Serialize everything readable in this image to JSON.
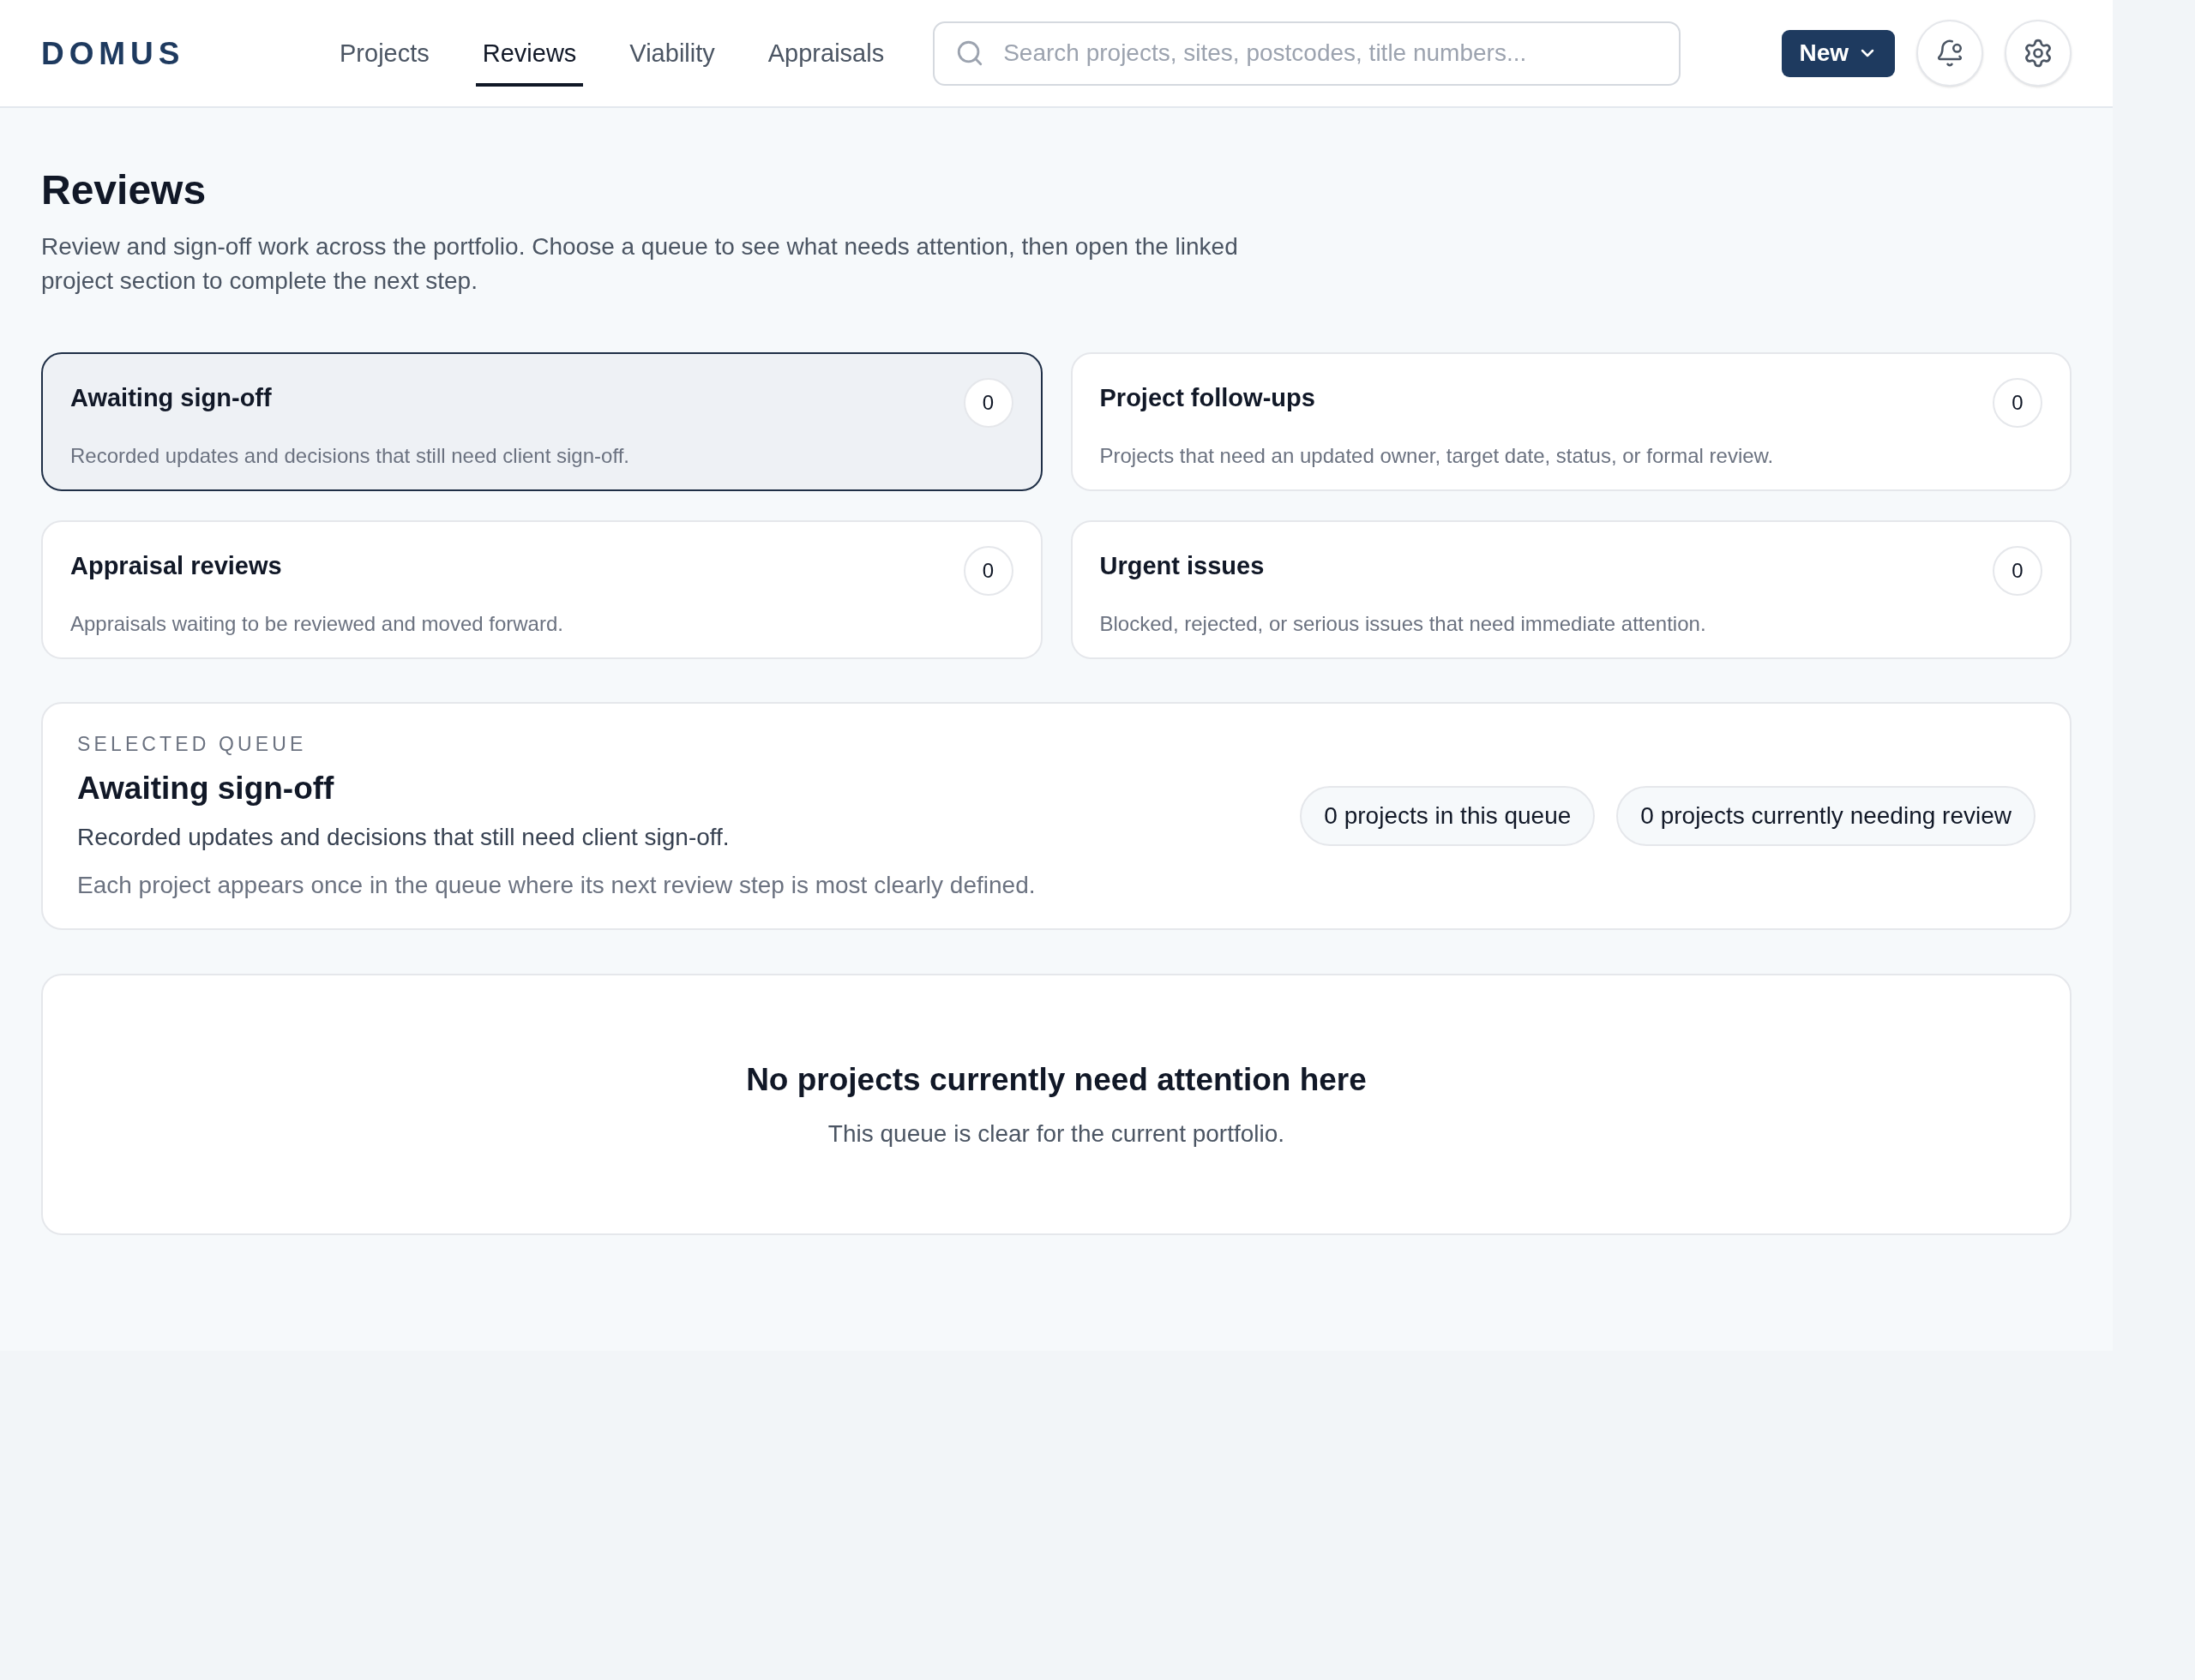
{
  "brand": "DOMUS",
  "nav": {
    "tabs": [
      {
        "label": "Projects",
        "selected": false
      },
      {
        "label": "Reviews",
        "selected": true
      },
      {
        "label": "Viability",
        "selected": false
      },
      {
        "label": "Appraisals",
        "selected": false
      }
    ]
  },
  "search": {
    "placeholder": "Search projects, sites, postcodes, title numbers..."
  },
  "new_button": {
    "label": "New"
  },
  "page": {
    "title": "Reviews",
    "description": "Review and sign-off work across the portfolio. Choose a queue to see what needs attention, then open the linked project section to complete the next step."
  },
  "queues": [
    {
      "title": "Awaiting sign-off",
      "description": "Recorded updates and decisions that still need client sign-off.",
      "count": "0",
      "selected": true
    },
    {
      "title": "Project follow-ups",
      "description": "Projects that need an updated owner, target date, status, or formal review.",
      "count": "0",
      "selected": false
    },
    {
      "title": "Appraisal reviews",
      "description": "Appraisals waiting to be reviewed and moved forward.",
      "count": "0",
      "selected": false
    },
    {
      "title": "Urgent issues",
      "description": "Blocked, rejected, or serious issues that need immediate attention.",
      "count": "0",
      "selected": false
    }
  ],
  "selected_queue": {
    "label": "SELECTED QUEUE",
    "title": "Awaiting sign-off",
    "description": "Recorded updates and decisions that still need client sign-off.",
    "note": "Each project appears once in the queue where its next review step is most clearly defined.",
    "pills": [
      "0 projects in this queue",
      "0 projects currently needing review"
    ]
  },
  "empty_state": {
    "title": "No projects currently need attention here",
    "message": "This queue is clear for the current portfolio."
  }
}
